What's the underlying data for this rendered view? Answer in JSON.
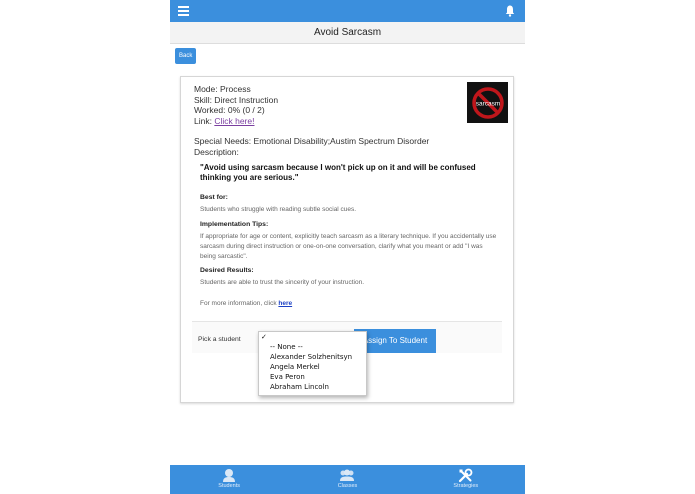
{
  "header": {
    "title": "Avoid Sarcasm",
    "back_label": "Back"
  },
  "card": {
    "mode": "Mode: Process",
    "skill": "Skill: Direct Instruction",
    "worked": "Worked: 0% (0 / 2)",
    "link_prefix": "Link: ",
    "link_text": "Click here!",
    "thumb_text": "sarcasm",
    "special_needs": "Special Needs: Emotional Disability;Austim Spectrum Disorder",
    "description_label": "Description:",
    "quote": "\"Avoid using sarcasm because I won't pick up on it and will be confused thinking you are serious.\"",
    "best_for_heading": "Best for:",
    "best_for_text": "Students who struggle with reading subtle social cues.",
    "impl_heading": "Implementation Tips:",
    "impl_text": "If appropriate for age or content, explicitly teach sarcasm as a literary technique. If you accidentally use sarcasm during direct instruction or one-on-one conversation, clarify what you meant or add \"I was being sarcastic\".",
    "results_heading": "Desired Results:",
    "results_text": "Students are able to trust the sincerity of your instruction.",
    "more_info_prefix": "For more information, click ",
    "more_info_link": "here"
  },
  "picker": {
    "label": "Pick a student",
    "assign_label": "Assign To Student",
    "checkmark": "✓",
    "options": [
      "-- None --",
      "Alexander Solzhenitsyn",
      "Angela Merkel",
      "Eva Peron",
      "Abraham Lincoln"
    ]
  },
  "nav": {
    "items": [
      {
        "label": "Students",
        "icon": "student-icon"
      },
      {
        "label": "Classes",
        "icon": "classes-icon"
      },
      {
        "label": "Strategies",
        "icon": "tools-icon"
      }
    ]
  },
  "colors": {
    "accent": "#3b8fdd",
    "link": "#7a3ea0"
  }
}
